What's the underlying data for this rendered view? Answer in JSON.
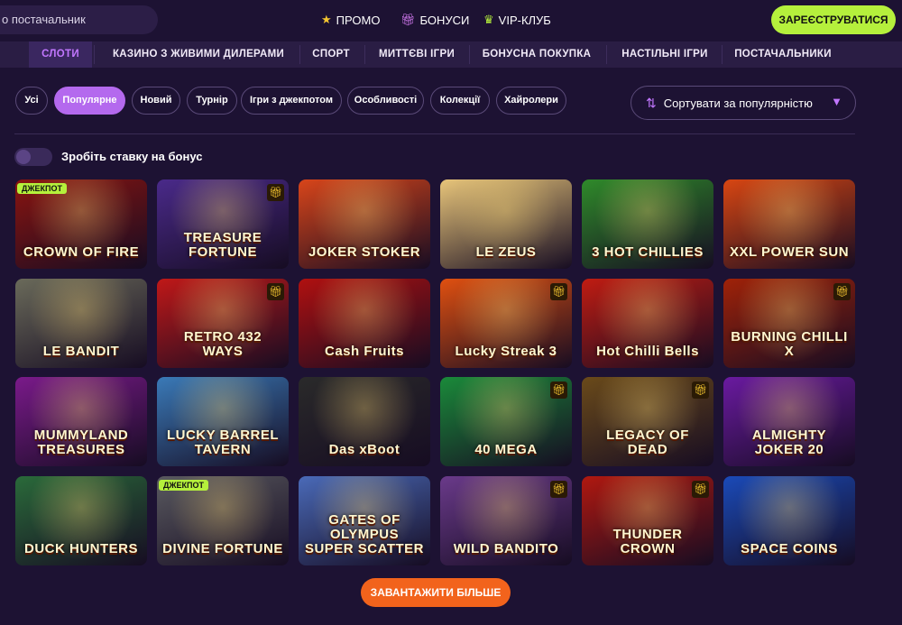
{
  "header": {
    "search_placeholder": "о постачальник",
    "promo": "ПРОМО",
    "bonuses": "БОНУСИ",
    "vip": "VIP-КЛУБ",
    "register": "ЗАРЕЄСТРУВАТИСЯ"
  },
  "categories": [
    "СЛОТИ",
    "КАЗИНО З ЖИВИМИ ДИЛЕРАМИ",
    "СПОРТ",
    "МИТТЄВІ ІГРИ",
    "БОНУСНА ПОКУПКА",
    "НАСТІЛЬНІ ІГРИ",
    "ПОСТАЧАЛЬНИКИ"
  ],
  "filters": [
    "Усі",
    "Популярне",
    "Новий",
    "Турнір",
    "Ігри з джекпотом",
    "Особливості",
    "Колекції",
    "Хайролери"
  ],
  "sort_label": "Сортувати за популярністю",
  "toggle_label": "Зробіть ставку на бонус",
  "badge_jackpot": "ДЖЕКПОТ",
  "games": [
    {
      "title": "CROWN OF FIRE",
      "color": "#8a1410"
    },
    {
      "title": "TREASURE FORTUNE",
      "color": "#4a2a8a"
    },
    {
      "title": "JOKER STOKER",
      "color": "#d8451a"
    },
    {
      "title": "LE ZEUS",
      "color": "#e8c57a"
    },
    {
      "title": "3 HOT CHILLIES",
      "color": "#2f8a2a"
    },
    {
      "title": "XXL POWER SUN",
      "color": "#d84612"
    },
    {
      "title": "LE BANDIT",
      "color": "#6a6a5a"
    },
    {
      "title": "RETRO 432 WAYS",
      "color": "#c01818"
    },
    {
      "title": "Cash Fruits",
      "color": "#b01010"
    },
    {
      "title": "Lucky Streak 3",
      "color": "#e05010"
    },
    {
      "title": "Hot Chilli Bells",
      "color": "#c01c12"
    },
    {
      "title": "BURNING CHILLI X",
      "color": "#a02208"
    },
    {
      "title": "MUMMYLAND TREASURES",
      "color": "#7a1a8a"
    },
    {
      "title": "LUCKY BARREL TAVERN",
      "color": "#3a7ab8"
    },
    {
      "title": "Das xBoot",
      "color": "#2a2a2a"
    },
    {
      "title": "40 MEGA",
      "color": "#1a8a3a"
    },
    {
      "title": "LEGACY OF DEAD",
      "color": "#6a4a1a"
    },
    {
      "title": "ALMIGHTY JOKER 20",
      "color": "#6a1aa0"
    },
    {
      "title": "DUCK HUNTERS",
      "color": "#2a6a3a"
    },
    {
      "title": "DIVINE FORTUNE",
      "color": "#5a5a60"
    },
    {
      "title": "GATES OF OLYMPUS SUPER SCATTER",
      "color": "#4a6ab8"
    },
    {
      "title": "WILD BANDITO",
      "color": "#6a3a8a"
    },
    {
      "title": "THUNDER CROWN",
      "color": "#b01810"
    },
    {
      "title": "SPACE COINS",
      "color": "#1a4ab8"
    }
  ],
  "load_more": "ЗАВАНТАЖИТИ БІЛЬШЕ"
}
